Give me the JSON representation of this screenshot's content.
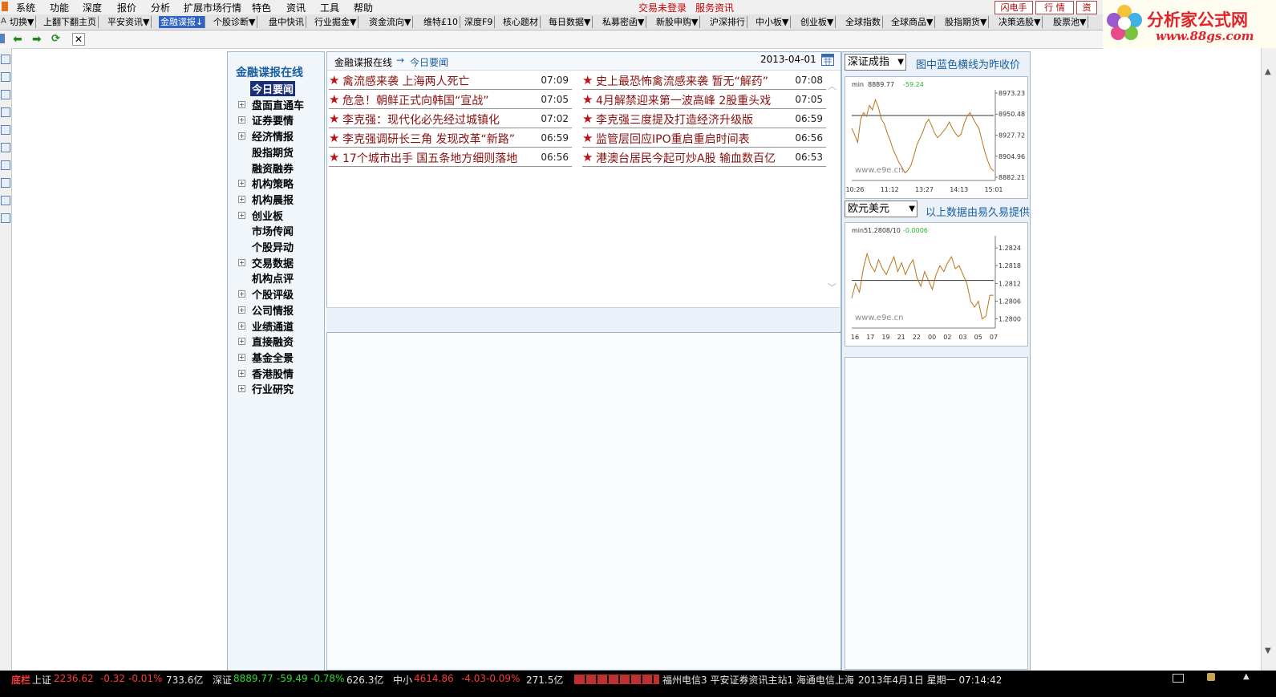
{
  "menubar": {
    "items": [
      "系统",
      "功能",
      "深度",
      "报价",
      "分析",
      "扩展市场行情",
      "特色",
      "资讯",
      "工具",
      "帮助"
    ],
    "status_links": [
      "交易未登录",
      "服务资讯"
    ],
    "buttons": [
      "闪电手",
      "行 情",
      "资"
    ]
  },
  "toolbar": {
    "items": [
      "切换▼",
      "上翻下翻主页",
      "平安资讯▼",
      "金融谍报↓",
      "个股诊断▼",
      "盘中快讯",
      "行业掘金▼",
      "资金流向▼",
      "维特£10",
      "深度F9",
      "核心题材",
      "每日数据▼",
      "私募密函▼",
      "新股申购▼",
      "沪深排行",
      "中小板▼",
      "创业板▼",
      "全球指数",
      "全球商品▼",
      "股指期货▼",
      "决策选股▼",
      "股票池▼"
    ],
    "active_index": 3
  },
  "logo": {
    "text": "分析家公式网",
    "url": "www.88gs.com"
  },
  "category": {
    "title": "金融谍报在线",
    "items": [
      {
        "label": "今日要闻",
        "expandable": false,
        "selected": true
      },
      {
        "label": "盘面直通车",
        "expandable": true
      },
      {
        "label": "证券要情",
        "expandable": true
      },
      {
        "label": "经济情报",
        "expandable": true
      },
      {
        "label": "股指期货",
        "expandable": false
      },
      {
        "label": "融资融券",
        "expandable": false
      },
      {
        "label": "机构策略",
        "expandable": true
      },
      {
        "label": "机构晨报",
        "expandable": true
      },
      {
        "label": "创业板",
        "expandable": true
      },
      {
        "label": "市场传闻",
        "expandable": false
      },
      {
        "label": "个股异动",
        "expandable": false
      },
      {
        "label": "交易数据",
        "expandable": true
      },
      {
        "label": "机构点评",
        "expandable": false
      },
      {
        "label": "个股评级",
        "expandable": true
      },
      {
        "label": "公司情报",
        "expandable": true
      },
      {
        "label": "业绩通道",
        "expandable": true
      },
      {
        "label": "直接融资",
        "expandable": true
      },
      {
        "label": "基金全景",
        "expandable": true
      },
      {
        "label": "香港股情",
        "expandable": true
      },
      {
        "label": "行业研究",
        "expandable": true
      }
    ]
  },
  "news": {
    "breadcrumb_root": "金融谍报在线",
    "breadcrumb_arrow": "→",
    "breadcrumb_current": "今日要闻",
    "date": "2013-04-01",
    "star": "★",
    "left": [
      {
        "title": "禽流感来袭 上海两人死亡",
        "time": "07:09"
      },
      {
        "title": "危急！朝鲜正式向韩国“宣战”",
        "time": "07:05"
      },
      {
        "title": "李克强：现代化必先经过城镇化",
        "time": "07:02"
      },
      {
        "title": "李克强调研长三角 发现改革“新路”",
        "time": "06:59"
      },
      {
        "title": "17个城市出手 国五条地方细则落地",
        "time": "06:56"
      }
    ],
    "right": [
      {
        "title": "史上最恐怖禽流感来袭 暂无“解药”",
        "time": "07:08"
      },
      {
        "title": "4月解禁迎来第一波高峰 2股重头戏",
        "time": "07:05"
      },
      {
        "title": "李克强三度提及打造经济升级版",
        "time": "06:59"
      },
      {
        "title": "监管层回应IPO重启重启时间表",
        "time": "06:56"
      },
      {
        "title": "港澳台居民今起可炒A股 输血数百亿",
        "time": "06:53"
      }
    ]
  },
  "right_panel": {
    "index_select": "深证成指",
    "index_note": "图中蓝色横线为昨收价",
    "fx_select": "欧元美元",
    "fx_note": "以上数据由易久易提供",
    "chart1": {
      "header_label": "min",
      "header_value": "8889.77",
      "header_change": "-59.24",
      "watermark": "www.e9e.cn",
      "y_ticks": [
        "8973.23",
        "8950.48",
        "8927.72",
        "8904.96",
        "8882.21"
      ],
      "x_ticks": [
        "10:26",
        "11:12",
        "13:27",
        "14:13",
        "15:01"
      ],
      "ylim": [
        8882.21,
        8973.23
      ],
      "prev_close": 8949.01,
      "series_color": "#b8741a",
      "values": [
        8935,
        8928,
        8920,
        8945,
        8952,
        8948,
        8960,
        8955,
        8966,
        8958,
        8945,
        8940,
        8930,
        8922,
        8912,
        8905,
        8898,
        8893,
        8887,
        8890,
        8895,
        8905,
        8917,
        8924,
        8931,
        8940,
        8945,
        8938,
        8930,
        8925,
        8928,
        8932,
        8936,
        8942,
        8935,
        8930,
        8926,
        8929,
        8940,
        8948,
        8952,
        8946,
        8940,
        8935,
        8922,
        8910,
        8900,
        8892,
        8889
      ]
    },
    "chart2": {
      "header_label": "min5",
      "header_value": "1.2808/10",
      "header_change": "-0.0006",
      "watermark": "www.e9e.cn",
      "y_ticks": [
        "1.2824",
        "1.2818",
        "1.2812",
        "1.2806",
        "1.2800"
      ],
      "x_ticks": [
        "16",
        "17",
        "19",
        "21",
        "22",
        "00",
        "02",
        "03",
        "05",
        "07"
      ],
      "ylim": [
        1.2798,
        1.2827
      ],
      "prev_close": 1.2813,
      "series_color": "#b8741a",
      "values": [
        1.2807,
        1.2812,
        1.2809,
        1.2817,
        1.2822,
        1.2818,
        1.2816,
        1.282,
        1.2817,
        1.2815,
        1.2818,
        1.2821,
        1.2816,
        1.2819,
        1.2815,
        1.2818,
        1.282,
        1.2814,
        1.2811,
        1.2816,
        1.2813,
        1.281,
        1.2815,
        1.2818,
        1.2816,
        1.2819,
        1.2821,
        1.2817,
        1.2818,
        1.2815,
        1.2812,
        1.2806,
        1.2804,
        1.2806,
        1.28,
        1.2801,
        1.2808,
        1.2808
      ]
    }
  },
  "statusbar": {
    "prefix": "底栏",
    "sh": {
      "name": "上证",
      "value": "2236.62",
      "change": "-0.32",
      "pct": "-0.01%",
      "amount": "733.6亿"
    },
    "sz": {
      "name": "深证",
      "value": "8889.77",
      "change": "-59.49",
      "pct": "-0.78%",
      "amount": "626.3亿"
    },
    "zx": {
      "name": "中小",
      "value": "4614.86",
      "change": "-4.03",
      "pct": "-0.09%",
      "amount": "271.5亿"
    },
    "servers": "福州电信3  平安证券资讯主站1  海通电信上海",
    "datetime": "2013年4月1日  星期一  07:14:42"
  }
}
